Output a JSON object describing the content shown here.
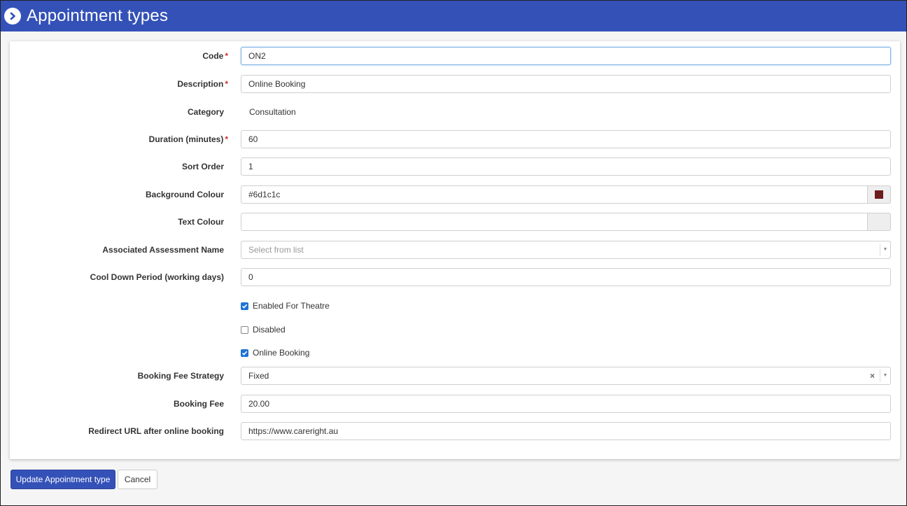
{
  "header": {
    "title": "Appointment types",
    "icon": "chevron-right-circle-icon"
  },
  "form": {
    "code": {
      "label": "Code",
      "required": "*",
      "value": "ON2"
    },
    "description": {
      "label": "Description",
      "required": "*",
      "value": "Online Booking"
    },
    "category": {
      "label": "Category",
      "value": "Consultation"
    },
    "duration": {
      "label": "Duration (minutes)",
      "required": "*",
      "value": "60"
    },
    "sort_order": {
      "label": "Sort Order",
      "value": "1"
    },
    "background_colour": {
      "label": "Background Colour",
      "value": "#6d1c1c",
      "swatch": "#6d1c1c"
    },
    "text_colour": {
      "label": "Text Colour",
      "value": ""
    },
    "assessment": {
      "label": "Associated Assessment Name",
      "placeholder": "Select from list"
    },
    "cool_down": {
      "label": "Cool Down Period (working days)",
      "value": "0"
    },
    "enabled_for_theatre": {
      "label": "Enabled For Theatre",
      "checked": true
    },
    "disabled": {
      "label": "Disabled",
      "checked": false
    },
    "online_booking": {
      "label": "Online Booking",
      "checked": true
    },
    "booking_fee_strategy": {
      "label": "Booking Fee Strategy",
      "value": "Fixed",
      "clear": "×"
    },
    "booking_fee": {
      "label": "Booking Fee",
      "value": "20.00"
    },
    "redirect_url": {
      "label": "Redirect URL after online booking",
      "value": "https://www.careright.au"
    }
  },
  "actions": {
    "update_label": "Update Appointment type",
    "cancel_label": "Cancel"
  },
  "colors": {
    "header": "#3451b8",
    "primary": "#3451b8",
    "required": "#d32f2f",
    "checkbox": "#1f73d6"
  }
}
